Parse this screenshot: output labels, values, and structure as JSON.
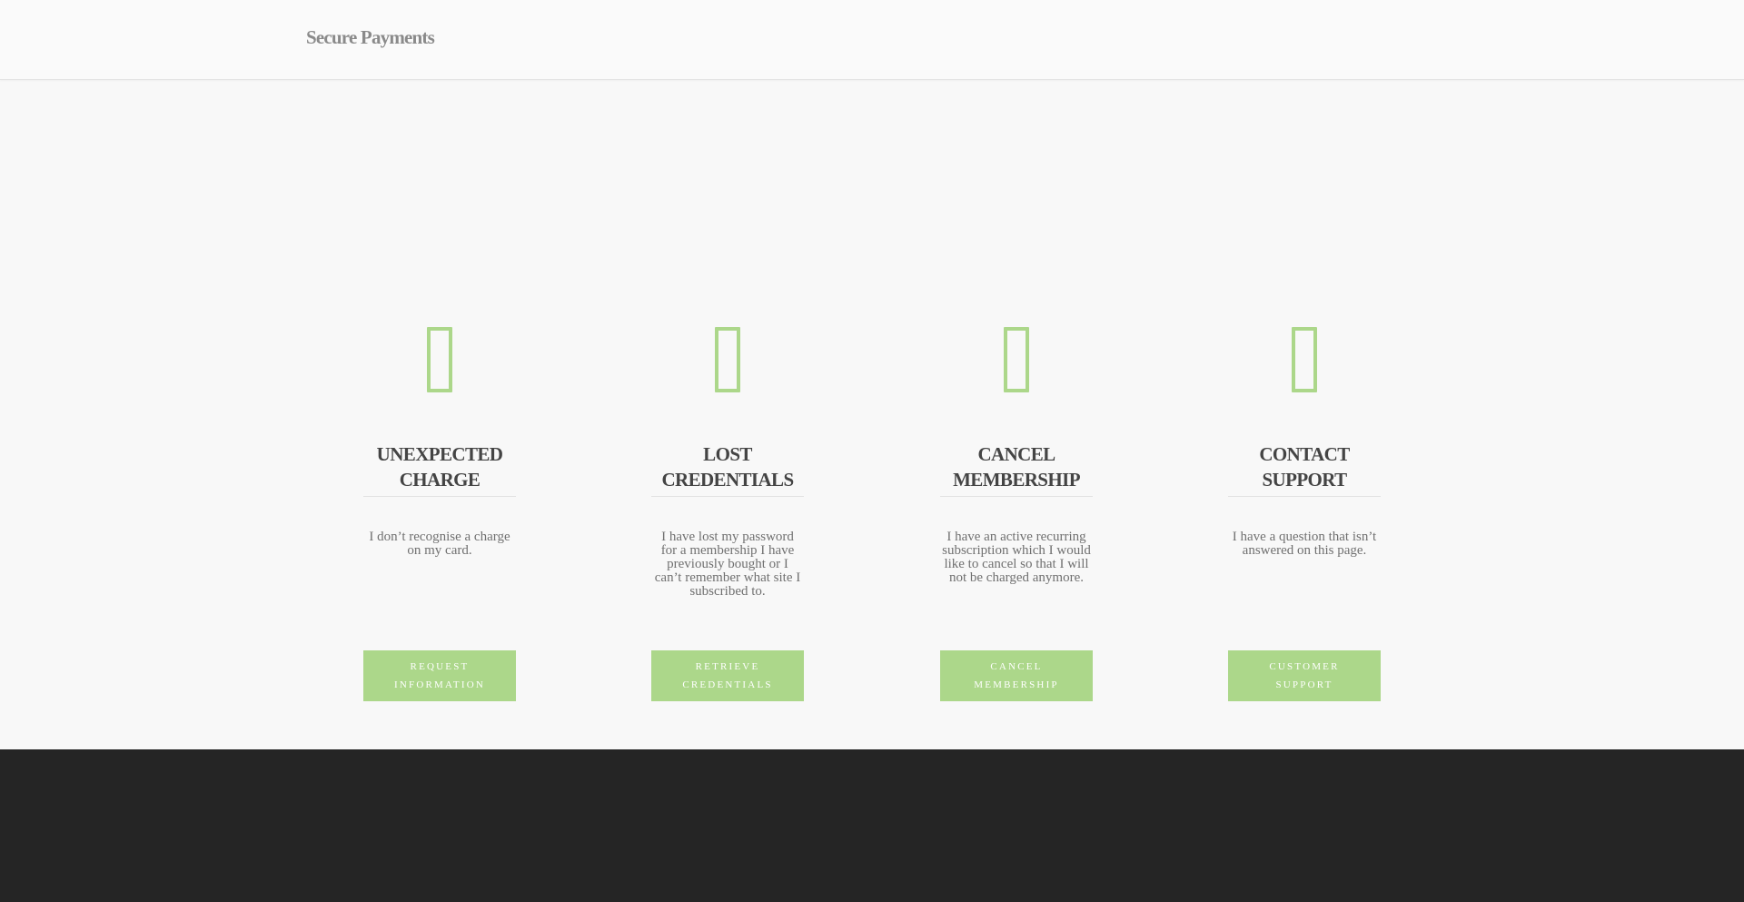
{
  "header": {
    "brand": "Secure Payments"
  },
  "colors": {
    "accent": "#acd78a",
    "footer": "#252525",
    "background": "#f8f8f8"
  },
  "cards": [
    {
      "icon": "credit-card-icon",
      "title_line1": "UNEXPECTED",
      "title_line2": "CHARGE",
      "description": "I don’t recognise a charge on my card.",
      "button_line1": "REQUEST",
      "button_line2": "INFORMATION"
    },
    {
      "icon": "key-icon",
      "title_line1": "LOST",
      "title_line2": "CREDENTIALS",
      "description": "I have lost my password for a membership I have previously bought or I can’t remember what site I subscribed to.",
      "button_line1": "RETRIEVE",
      "button_line2": "CREDENTIALS"
    },
    {
      "icon": "cancel-icon",
      "title_line1": "CANCEL",
      "title_line2": "MEMBERSHIP",
      "description": "I have an active recurring subscription which I would like to cancel so that I will not be charged anymore.",
      "button_line1": "CANCEL",
      "button_line2": "MEMBERSHIP"
    },
    {
      "icon": "support-icon",
      "title_line1": "CONTACT",
      "title_line2": "SUPPORT",
      "description": "I have a question that isn’t answered on this page.",
      "button_line1": "CUSTOMER",
      "button_line2": "SUPPORT"
    }
  ]
}
